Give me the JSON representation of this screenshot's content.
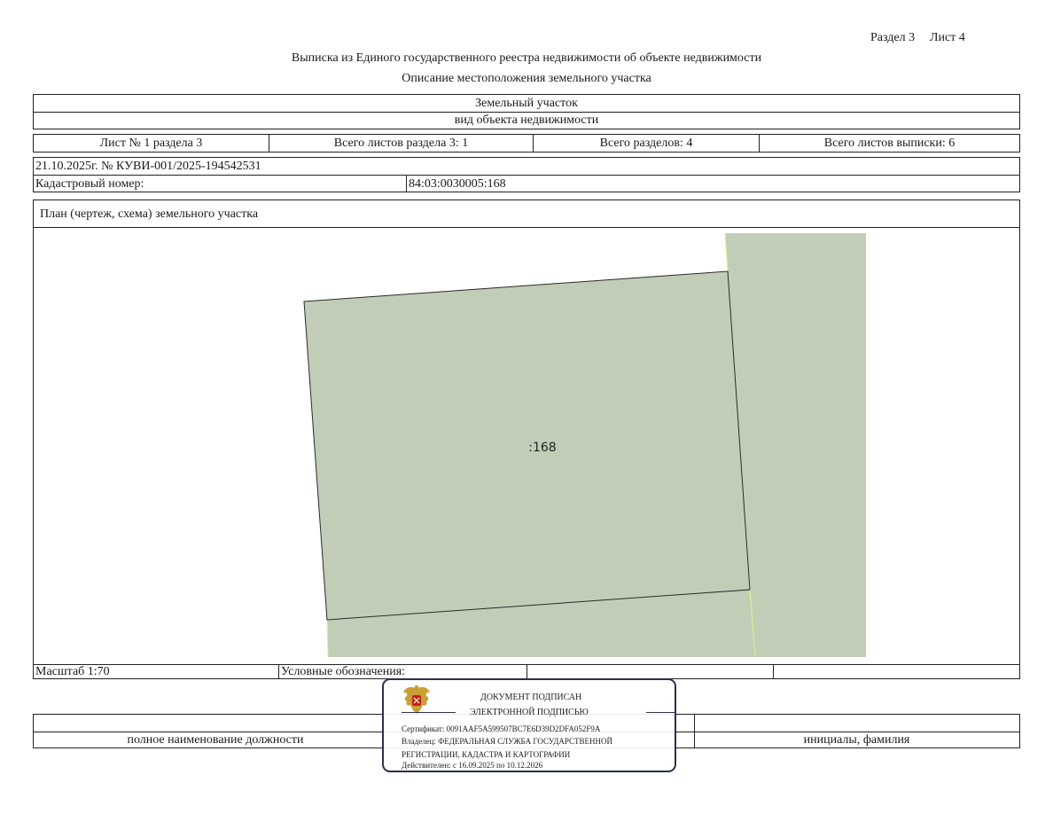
{
  "header": {
    "section": "Раздел 3",
    "sheet": "Лист 4",
    "title": "Выписка из Единого государственного реестра недвижимости об объекте недвижимости",
    "subtitle": "Описание местоположения земельного участка"
  },
  "object": {
    "type": "Земельный участок",
    "type_caption": "вид объекта недвижимости"
  },
  "sheets_row": {
    "sheet_no": "Лист № 1 раздела 3",
    "total_section_sheets": "Всего листов раздела 3: 1",
    "total_sections": "Всего разделов: 4",
    "total_extract_sheets": "Всего листов выписки: 6"
  },
  "record": {
    "date_number": "21.10.2025г. № КУВИ-001/2025-194542531",
    "cadastral_label": "Кадастровый номер:",
    "cadastral_value": "84:03:0030005:168"
  },
  "plan": {
    "title": "План (чертеж, схема) земельного участка",
    "parcel_label": ":168",
    "parcel_color": "#c2cdb8",
    "neighbor_color": "#c2cdb8",
    "border_color": "#e6f08a"
  },
  "footer": {
    "scale": "Масштаб 1:70",
    "legend_label": "Условные обозначения:",
    "position_caption": "полное наименование должности",
    "name_caption": "инициалы, фамилия"
  },
  "stamp": {
    "line1": "ДОКУМЕНТ ПОДПИСАН",
    "line2": "ЭЛЕКТРОННОЙ ПОДПИСЬЮ",
    "certificate": "Сертификат: 0091AAF5A599507BC7E6D39D2DFA052F9A",
    "owner_line1": "Владелец: ФЕДЕРАЛЬНАЯ СЛУЖБА ГОСУДАРСТВЕННОЙ",
    "owner_line2": "РЕГИСТРАЦИИ, КАДАСТРА И КАРТОГРАФИИ",
    "valid": "Действителен: с 16.09.2025 по 10.12.2026",
    "emblem_icon": "coat-of-arms-icon"
  }
}
